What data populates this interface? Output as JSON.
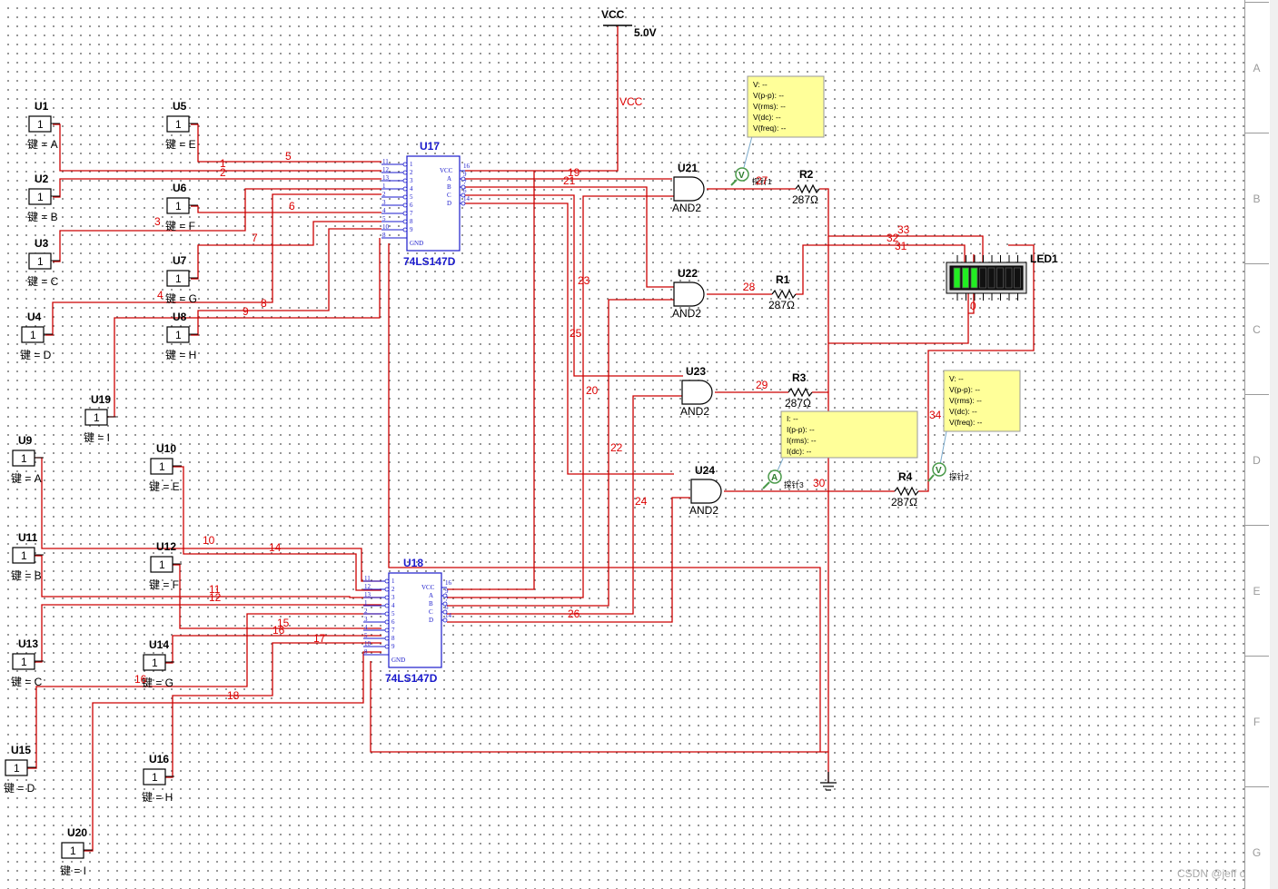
{
  "power": {
    "vcc_label": "VCC",
    "vcc_value": "5.0V",
    "vcc_net": "VCC"
  },
  "switches": [
    {
      "name": "U1",
      "key": "键 = A",
      "val": "1"
    },
    {
      "name": "U2",
      "key": "键 = B",
      "val": "1"
    },
    {
      "name": "U3",
      "key": "键 = C",
      "val": "1"
    },
    {
      "name": "U4",
      "key": "键 = D",
      "val": "1"
    },
    {
      "name": "U5",
      "key": "键 = E",
      "val": "1"
    },
    {
      "name": "U6",
      "key": "键 = F",
      "val": "1"
    },
    {
      "name": "U7",
      "key": "键 = G",
      "val": "1"
    },
    {
      "name": "U8",
      "key": "键 = H",
      "val": "1"
    },
    {
      "name": "U19",
      "key": "键 = I",
      "val": "1"
    },
    {
      "name": "U9",
      "key": "键 = A",
      "val": "1"
    },
    {
      "name": "U10",
      "key": "键 = E",
      "val": "1"
    },
    {
      "name": "U11",
      "key": "键 = B",
      "val": "1"
    },
    {
      "name": "U12",
      "key": "键 = F",
      "val": "1"
    },
    {
      "name": "U13",
      "key": "键 = C",
      "val": "1"
    },
    {
      "name": "U14",
      "key": "键 = G",
      "val": "1"
    },
    {
      "name": "U15",
      "key": "键 = D",
      "val": "1"
    },
    {
      "name": "U16",
      "key": "键 = H",
      "val": "1"
    },
    {
      "name": "U20",
      "key": "键 = I",
      "val": "1"
    }
  ],
  "encoders": [
    {
      "name": "U17",
      "part": "74LS147D"
    },
    {
      "name": "U18",
      "part": "74LS147D"
    }
  ],
  "encoder_pins": {
    "left_nums": [
      "11",
      "12",
      "13",
      "1",
      "2",
      "3",
      "4",
      "5",
      "10"
    ],
    "left_labels": [
      "1",
      "2",
      "3",
      "4",
      "5",
      "6",
      "7",
      "8",
      "9"
    ],
    "gnd_num": "8",
    "gnd_label": "GND",
    "right_nums": [
      "16",
      "9",
      "7",
      "6",
      "14"
    ],
    "right_labels": [
      "VCC",
      "A",
      "B",
      "C",
      "D"
    ]
  },
  "gates": [
    {
      "name": "U21",
      "part": "AND2"
    },
    {
      "name": "U22",
      "part": "AND2"
    },
    {
      "name": "U23",
      "part": "AND2"
    },
    {
      "name": "U24",
      "part": "AND2"
    }
  ],
  "resistors": [
    {
      "name": "R2",
      "value": "287Ω"
    },
    {
      "name": "R1",
      "value": "287Ω"
    },
    {
      "name": "R3",
      "value": "287Ω"
    },
    {
      "name": "R4",
      "value": "287Ω"
    }
  ],
  "led": {
    "name": "LED1",
    "segments_on": 3,
    "segments_total": 8,
    "on_color": "#22ee22",
    "off_color": "#111111"
  },
  "probes": [
    {
      "symbol": "V",
      "label": "探针1",
      "lines": [
        "V: --",
        "V(p-p): --",
        "V(rms): --",
        "V(dc): --",
        "V(freq): --"
      ]
    },
    {
      "symbol": "A",
      "label": "探针3",
      "lines": [
        "I: --",
        "I(p-p): --",
        "I(rms): --",
        "I(dc): --"
      ]
    },
    {
      "symbol": "V",
      "label": "探针2",
      "lines": [
        "V: --",
        "V(p-p): --",
        "V(rms): --",
        "V(dc): --",
        "V(freq): --"
      ]
    }
  ],
  "nets": [
    "1",
    "2",
    "3",
    "4",
    "5",
    "6",
    "7",
    "8",
    "9",
    "10",
    "11",
    "12",
    "14",
    "15",
    "16",
    "17",
    "18",
    "19",
    "21",
    "20",
    "22",
    "23",
    "24",
    "25",
    "26",
    "27",
    "28",
    "29",
    "30",
    "31",
    "32",
    "33",
    "34",
    "0",
    "16"
  ],
  "zones": [
    "A",
    "B",
    "C",
    "D",
    "E",
    "F",
    "G"
  ],
  "watermark": "CSDN @jeff one",
  "colors": {
    "wire": "#cc0000",
    "ic": "#1a1acc",
    "probe_bg": "#ffff99",
    "led_on": "#22ee22"
  }
}
